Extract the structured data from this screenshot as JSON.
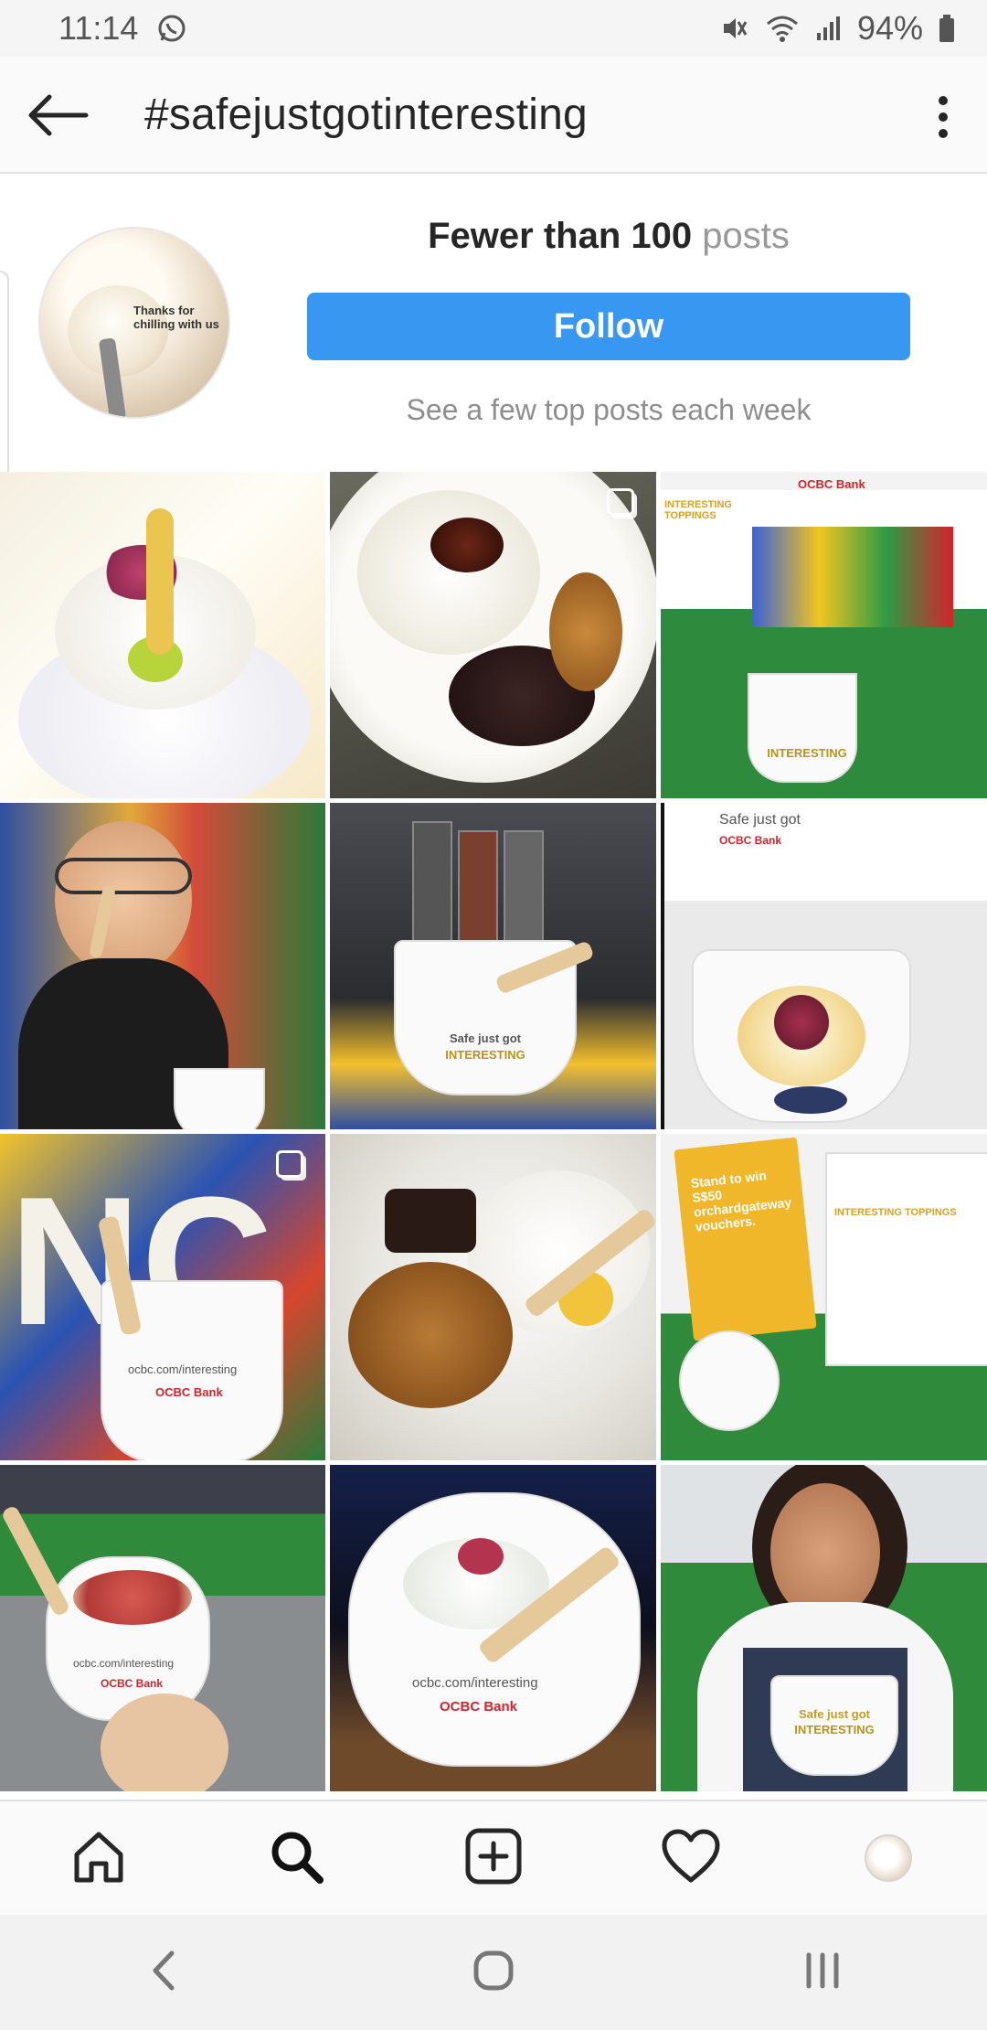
{
  "status_bar": {
    "time": "11:14",
    "battery": "94%",
    "icons": [
      "whatsapp-icon",
      "mute-icon",
      "wifi-icon",
      "signal-icon",
      "battery-icon"
    ]
  },
  "top_bar": {
    "back_icon": "back-arrow-icon",
    "title": "#safejustgotinteresting",
    "menu_icon": "more-vertical-icon"
  },
  "header": {
    "avatar_caption": "Thanks for chilling with us",
    "posts_count_label": "Fewer than 100",
    "posts_word": "posts",
    "follow_label": "Follow",
    "hint": "See a few top posts each week"
  },
  "grid": {
    "tiles": [
      {
        "id": 1,
        "description": "ice cream with rose petals",
        "multiple": false
      },
      {
        "id": 2,
        "description": "ice cream with toppings in bowl",
        "multiple": true
      },
      {
        "id": 3,
        "description": "OCBC Bank booth",
        "multiple": false
      },
      {
        "id": 4,
        "description": "child tasting ice cream",
        "multiple": false
      },
      {
        "id": 5,
        "description": "cup in front of topping dispensers",
        "multiple": false
      },
      {
        "id": 6,
        "description": "cup with rose petals",
        "multiple": false
      },
      {
        "id": 7,
        "description": "cup with ocbc.com/interesting",
        "multiple": true
      },
      {
        "id": 8,
        "description": "close-up of dessert",
        "multiple": false
      },
      {
        "id": 9,
        "description": "Stand to win sign",
        "multiple": false
      },
      {
        "id": 10,
        "description": "cup over paving",
        "multiple": false
      },
      {
        "id": 11,
        "description": "cup with wooden spoon",
        "multiple": false
      },
      {
        "id": 12,
        "description": "woman holding cup",
        "multiple": false
      }
    ],
    "tile_texts": {
      "booth_sign": "INTERESTING TOPPINGS",
      "bank": "OCBC Bank",
      "cup_safe": "Safe just got",
      "cup_interesting": "INTERESTING",
      "cup_url": "ocbc.com/interesting",
      "stand_sign": "Stand to win S$50 orchardgateway vouchers."
    }
  },
  "bottom_nav": {
    "items": [
      "home-icon",
      "search-icon",
      "add-post-icon",
      "activity-heart-icon",
      "profile-avatar"
    ],
    "active": "search-icon"
  },
  "system_nav": {
    "items": [
      "back-chevron-icon",
      "home-circle-icon",
      "recents-icon"
    ]
  }
}
